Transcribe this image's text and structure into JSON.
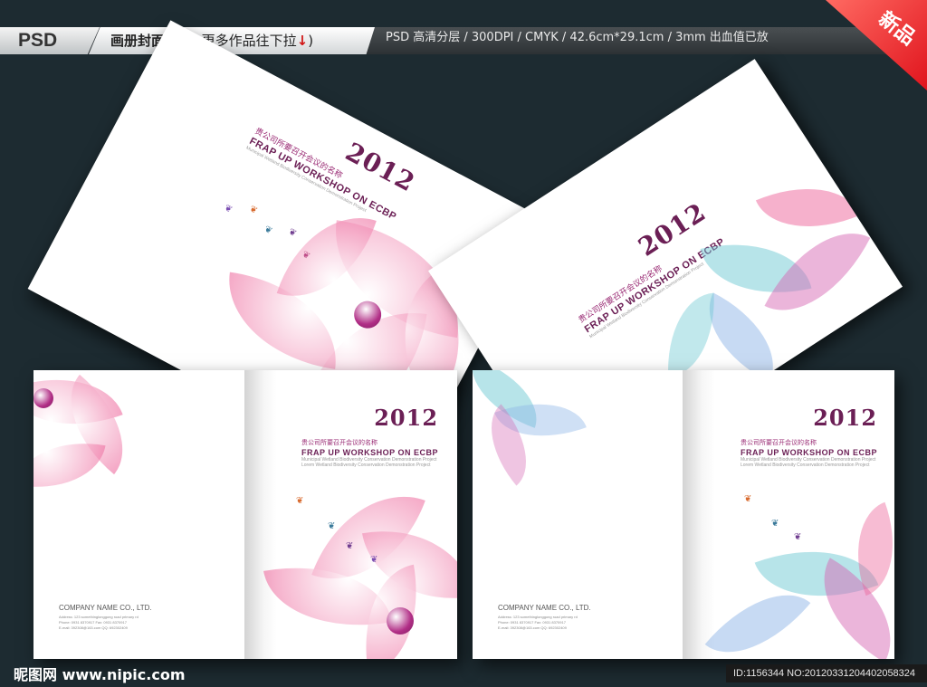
{
  "banner": {
    "psd_label": "PSD",
    "title": "画册封面设计",
    "subtitle": "( 更多作品往下拉",
    "arrow": "↓",
    "close": ")",
    "specs": "PSD 高清分层  /  300DPI  /  CMYK  /  42.6cm*29.1cm  /  3mm 出血值已放",
    "corner_badge": "新品"
  },
  "cover": {
    "year": "2012",
    "cn_title": "贵公司所要召开会议的名称",
    "en_title": "FRAP UP WORKSHOP ON ECBP",
    "en_sub1": "Municipal Wetland Biodiversity Conservation Demonstration Project",
    "en_sub2": "Lorem Wetland Biodiversity Conservation Demonstration Project"
  },
  "back": {
    "company": "COMPANY NAME CO., LTD.",
    "address": "Address: 123 somethinglonggong road primary rd",
    "phone": "Phone: 0931 8370917    Fax: 0931 8370917",
    "email": "E-mail: 392308@163.com    QQ: 692302409"
  },
  "footer": {
    "site": "昵图网 www.nipic.com",
    "id": "ID:1156344 NO:20120331204402058324"
  },
  "colors": {
    "background": "#1d2b31",
    "accent_purple": "#6b1f55",
    "badge_red": "#e0141d",
    "petal_pink": "#ec5f96",
    "leaf_teal": "#6cc7d2"
  }
}
